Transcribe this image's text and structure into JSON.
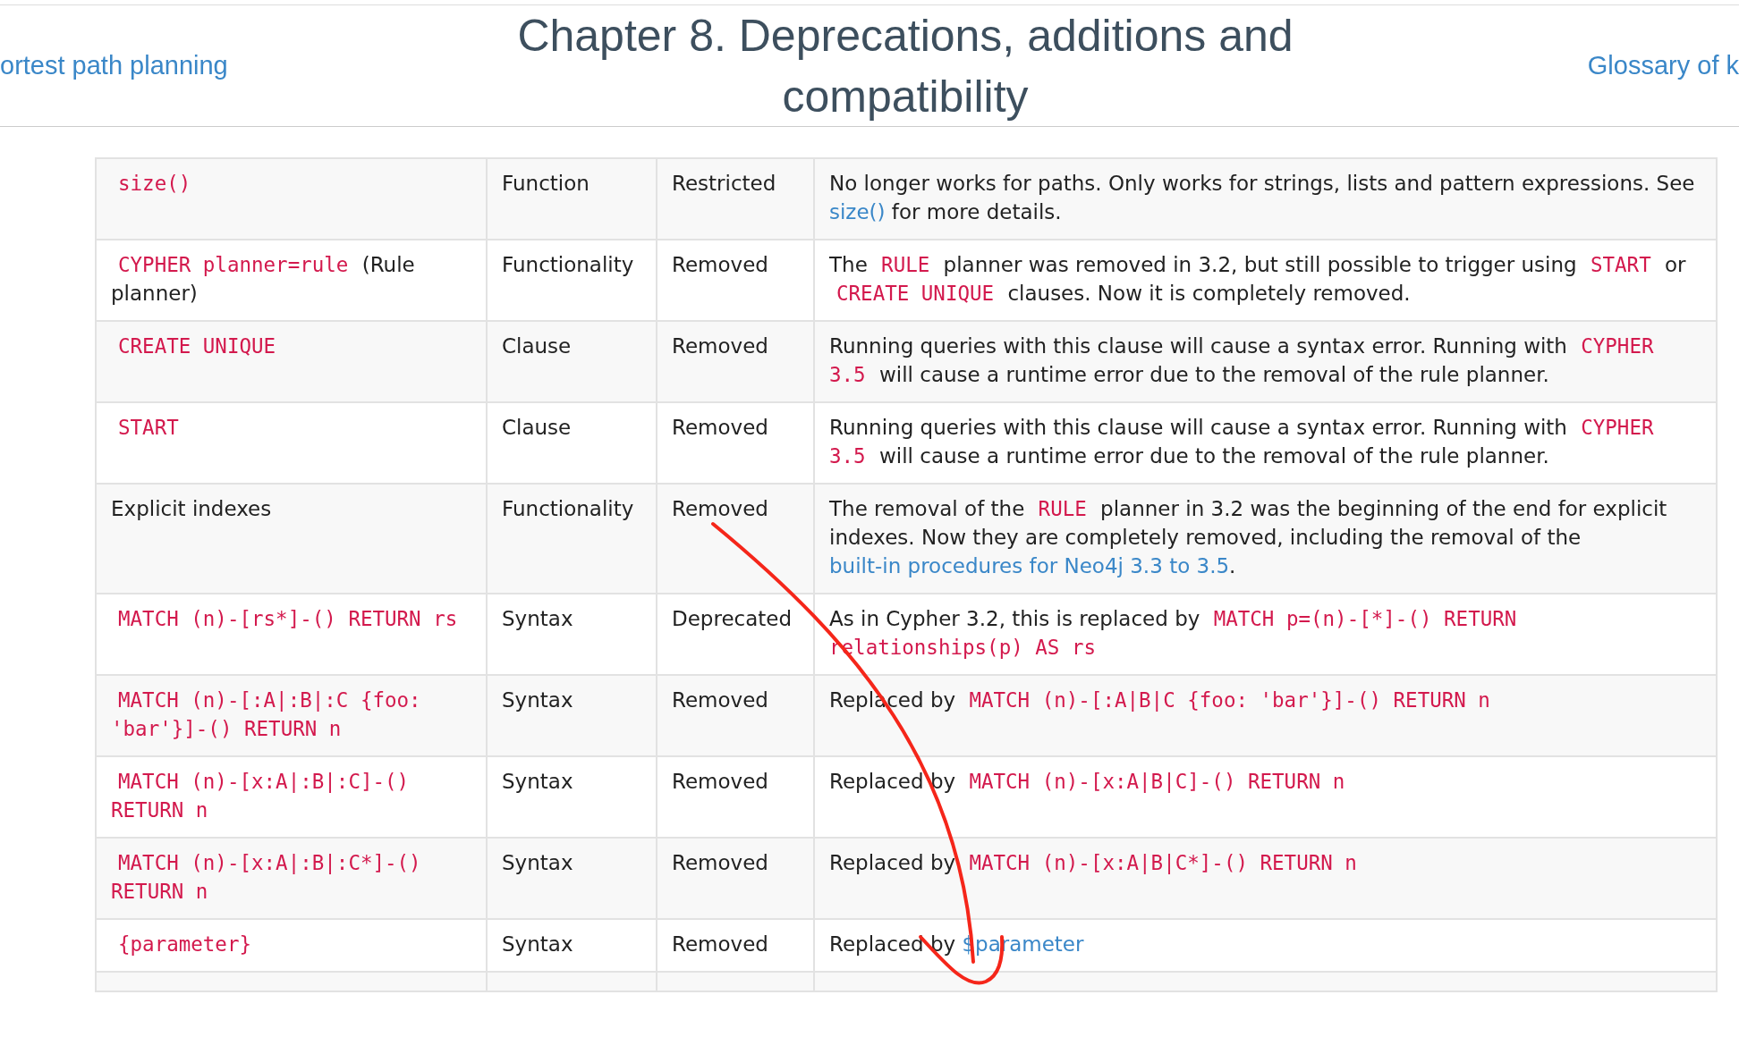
{
  "nav": {
    "previous": "ortest path planning",
    "title": "Chapter 8. Deprecations, additions and compatibility",
    "next": "Glossary of k"
  },
  "table": {
    "rows": [
      {
        "feature": [
          {
            "kind": "code",
            "text": "size()"
          }
        ],
        "type": "Function",
        "status": "Restricted",
        "description": [
          {
            "kind": "text",
            "text": "No longer works for paths. Only works for strings, lists and pattern expressions. See "
          },
          {
            "kind": "link",
            "text": "size()"
          },
          {
            "kind": "text",
            "text": " for more details."
          }
        ]
      },
      {
        "feature": [
          {
            "kind": "code",
            "text": "CYPHER planner=rule"
          },
          {
            "kind": "text",
            "text": " (Rule planner)"
          }
        ],
        "type": "Functionality",
        "status": "Removed",
        "description": [
          {
            "kind": "text",
            "text": "The "
          },
          {
            "kind": "code",
            "text": "RULE"
          },
          {
            "kind": "text",
            "text": " planner was removed in 3.2, but still possible to trigger using "
          },
          {
            "kind": "code",
            "text": "START"
          },
          {
            "kind": "text",
            "text": " or "
          },
          {
            "kind": "code",
            "text": "CREATE UNIQUE"
          },
          {
            "kind": "text",
            "text": " clauses. Now it is completely removed."
          }
        ]
      },
      {
        "feature": [
          {
            "kind": "code",
            "text": "CREATE UNIQUE"
          }
        ],
        "type": "Clause",
        "status": "Removed",
        "description": [
          {
            "kind": "text",
            "text": "Running queries with this clause will cause a syntax error. Running with "
          },
          {
            "kind": "code",
            "text": "CYPHER 3.5"
          },
          {
            "kind": "text",
            "text": " will cause a runtime error due to the removal of the rule planner."
          }
        ]
      },
      {
        "feature": [
          {
            "kind": "code",
            "text": "START"
          }
        ],
        "type": "Clause",
        "status": "Removed",
        "description": [
          {
            "kind": "text",
            "text": "Running queries with this clause will cause a syntax error. Running with "
          },
          {
            "kind": "code",
            "text": "CYPHER 3.5"
          },
          {
            "kind": "text",
            "text": " will cause a runtime error due to the removal of the rule planner."
          }
        ]
      },
      {
        "feature": [
          {
            "kind": "text",
            "text": "Explicit indexes"
          }
        ],
        "type": "Functionality",
        "status": "Removed",
        "description": [
          {
            "kind": "text",
            "text": "The removal of the "
          },
          {
            "kind": "code",
            "text": "RULE"
          },
          {
            "kind": "text",
            "text": " planner in 3.2 was the beginning of the end for explicit indexes. Now they are completely removed, including the removal of the "
          },
          {
            "kind": "link",
            "text": "built-in procedures for Neo4j 3.3 to 3.5"
          },
          {
            "kind": "text",
            "text": "."
          }
        ]
      },
      {
        "feature": [
          {
            "kind": "code",
            "text": "MATCH (n)-[rs*]-() RETURN rs"
          }
        ],
        "type": "Syntax",
        "status": "Deprecated",
        "description": [
          {
            "kind": "text",
            "text": "As in Cypher 3.2, this is replaced by "
          },
          {
            "kind": "code",
            "text": "MATCH p=(n)-[*]-() RETURN relationships(p) AS rs"
          }
        ]
      },
      {
        "feature": [
          {
            "kind": "code",
            "text": "MATCH (n)-[:A|:B|:C {foo: 'bar'}]-() RETURN n"
          }
        ],
        "type": "Syntax",
        "status": "Removed",
        "description": [
          {
            "kind": "text",
            "text": "Replaced by "
          },
          {
            "kind": "code",
            "text": "MATCH (n)-[:A|B|C {foo: 'bar'}]-() RETURN n"
          }
        ]
      },
      {
        "feature": [
          {
            "kind": "code",
            "text": "MATCH (n)-[x:A|:B|:C]-() RETURN n"
          }
        ],
        "type": "Syntax",
        "status": "Removed",
        "description": [
          {
            "kind": "text",
            "text": "Replaced by "
          },
          {
            "kind": "code",
            "text": "MATCH (n)-[x:A|B|C]-() RETURN n"
          }
        ]
      },
      {
        "feature": [
          {
            "kind": "code",
            "text": "MATCH (n)-[x:A|:B|:C*]-() RETURN n"
          }
        ],
        "type": "Syntax",
        "status": "Removed",
        "description": [
          {
            "kind": "text",
            "text": "Replaced by "
          },
          {
            "kind": "code",
            "text": "MATCH (n)-[x:A|B|C*]-() RETURN n"
          }
        ]
      },
      {
        "feature": [
          {
            "kind": "code",
            "text": "{parameter}"
          }
        ],
        "type": "Syntax",
        "status": "Removed",
        "description": [
          {
            "kind": "text",
            "text": "Replaced by "
          },
          {
            "kind": "link",
            "text": "$parameter"
          }
        ]
      }
    ]
  },
  "annotations": [
    {
      "kind": "arrow"
    }
  ]
}
